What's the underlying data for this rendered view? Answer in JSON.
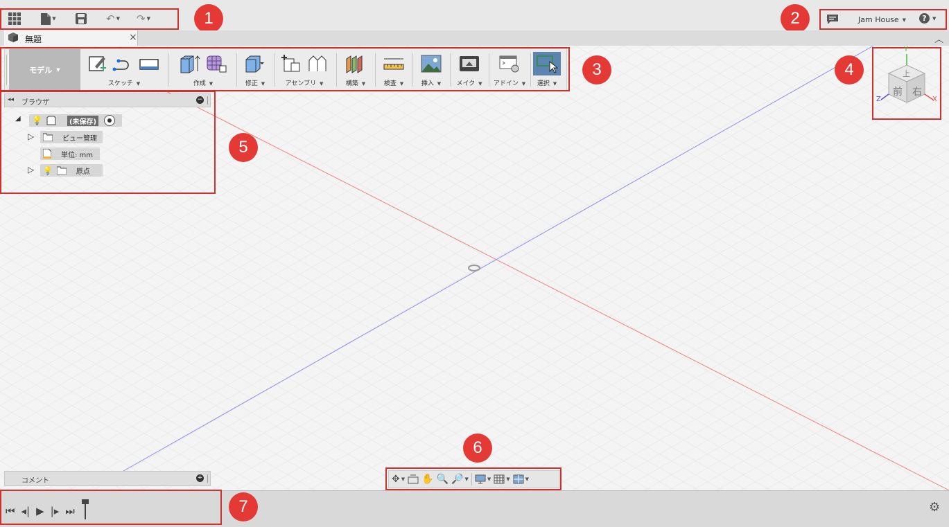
{
  "quick_access": {
    "apps_icon": "grid-apps-icon",
    "file_icon": "file-icon",
    "save_icon": "save-icon",
    "undo_icon": "undo-icon",
    "redo_icon": "redo-icon"
  },
  "header": {
    "user_name": "Jam House",
    "notifications_icon": "comment-icon",
    "help_icon": "help-icon"
  },
  "document_tab": {
    "title": "無題",
    "close": "×"
  },
  "toolbar": {
    "workspace": "モデル",
    "groups": [
      {
        "label": "スケッチ"
      },
      {
        "label": "作成"
      },
      {
        "label": "修正"
      },
      {
        "label": "アセンブリ"
      },
      {
        "label": "構築"
      },
      {
        "label": "検査"
      },
      {
        "label": "挿入"
      },
      {
        "label": "メイク"
      },
      {
        "label": "アドイン"
      },
      {
        "label": "選択"
      }
    ]
  },
  "viewcube": {
    "faces": {
      "top": "上",
      "front": "前",
      "right": "右"
    },
    "axes": {
      "x": "X",
      "y": "Y",
      "z": "Z"
    }
  },
  "browser": {
    "title": "ブラウザ",
    "root": "(未保存)",
    "items": [
      {
        "label": "ビュー管理"
      },
      {
        "label": "単位: mm"
      },
      {
        "label": "原点"
      }
    ]
  },
  "comments": {
    "title": "コメント"
  },
  "callouts": [
    "1",
    "2",
    "3",
    "4",
    "5",
    "6",
    "7"
  ],
  "colors": {
    "callout": "#e53935",
    "x_axis": "#e57373",
    "z_axis": "#7986cb",
    "select_active": "#5b84b1"
  }
}
